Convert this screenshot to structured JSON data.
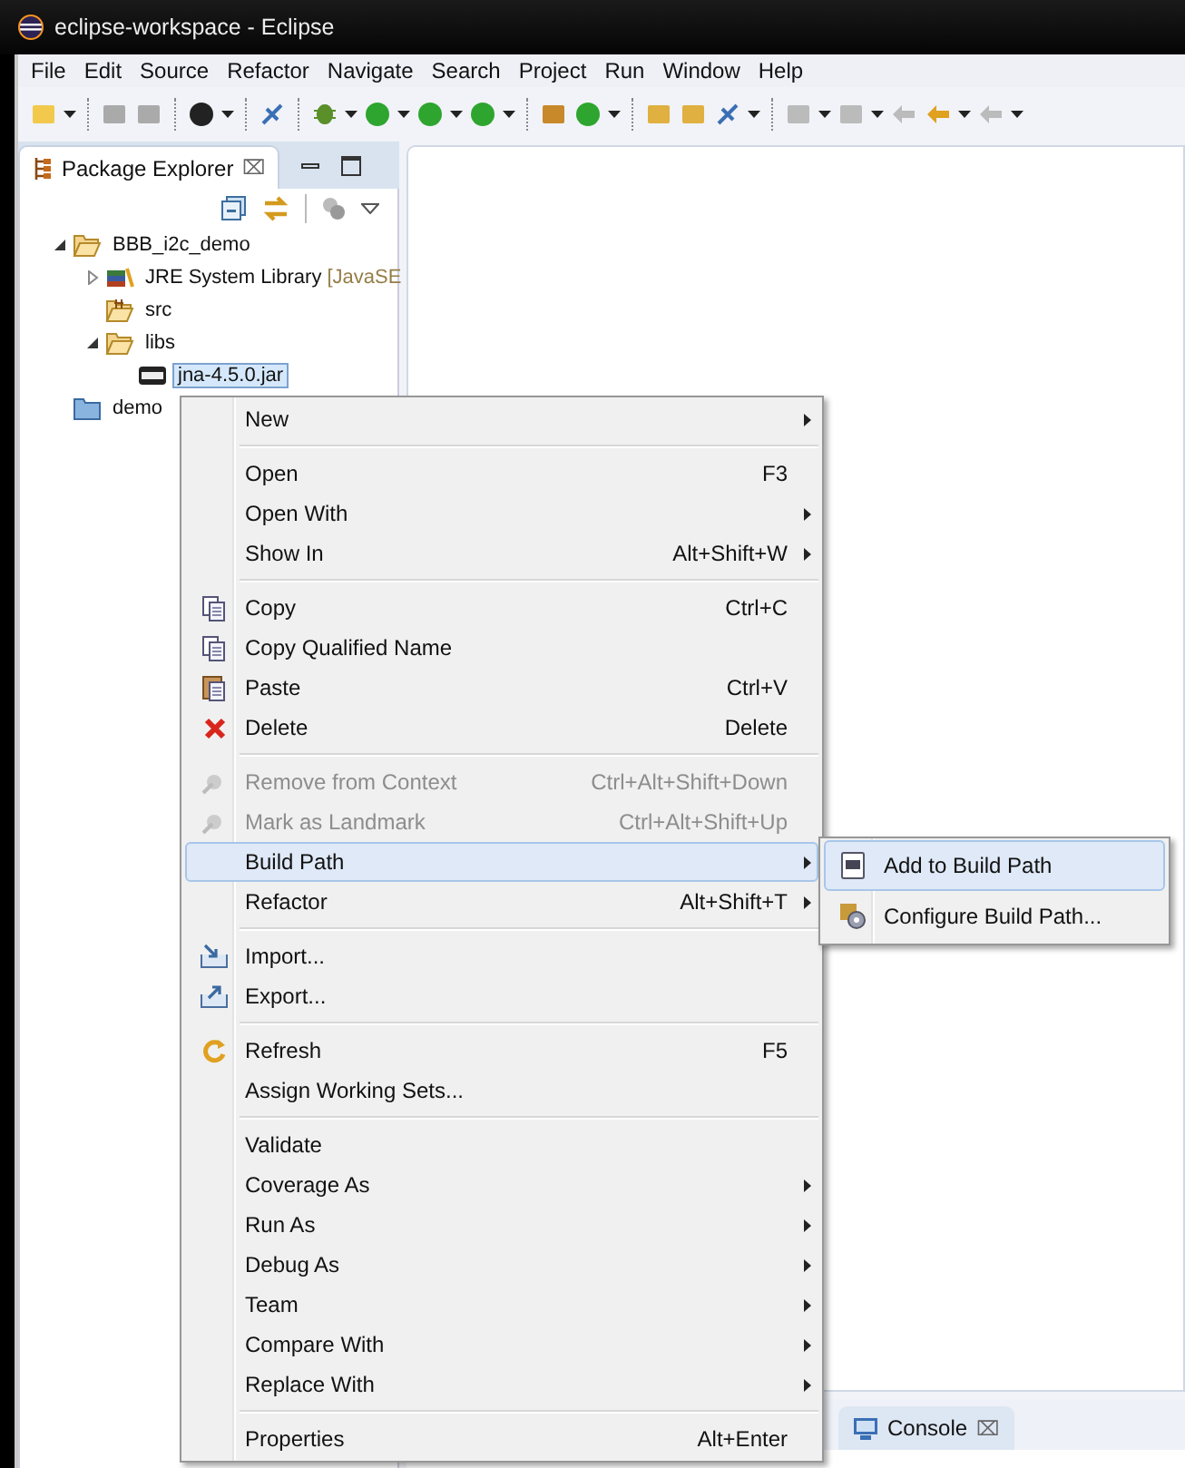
{
  "window": {
    "title": "eclipse-workspace - Eclipse"
  },
  "menu_bar": [
    "File",
    "Edit",
    "Source",
    "Refactor",
    "Navigate",
    "Search",
    "Project",
    "Run",
    "Window",
    "Help"
  ],
  "package_explorer": {
    "title": "Package Explorer",
    "close": "⌧",
    "tree": [
      {
        "label": "BBB_i2c_demo",
        "kind": "project",
        "expanded": true,
        "selected": false,
        "children": [
          {
            "label": "JRE System Library",
            "decoration": "[JavaSE",
            "kind": "library",
            "expanded": false,
            "selected": false
          },
          {
            "label": "src",
            "kind": "source",
            "selected": false
          },
          {
            "label": "libs",
            "kind": "folder",
            "expanded": true,
            "selected": false,
            "children": [
              {
                "label": "jna-4.5.0.jar",
                "kind": "jar",
                "selected": true
              }
            ]
          }
        ]
      },
      {
        "label": "demo",
        "kind": "closed-project",
        "selected": false
      }
    ]
  },
  "context_menu": {
    "items": [
      {
        "kind": "item",
        "label": "New",
        "submenu": true,
        "disabled": false,
        "selected": false
      },
      {
        "kind": "separator"
      },
      {
        "kind": "item",
        "label": "Open",
        "shortcut": "F3",
        "disabled": false,
        "selected": false
      },
      {
        "kind": "item",
        "label": "Open With",
        "submenu": true,
        "disabled": false,
        "selected": false
      },
      {
        "kind": "item",
        "label": "Show In",
        "shortcut": "Alt+Shift+W",
        "submenu": true,
        "disabled": false,
        "selected": false
      },
      {
        "kind": "separator"
      },
      {
        "kind": "item",
        "label": "Copy",
        "shortcut": "Ctrl+C",
        "disabled": false,
        "selected": false
      },
      {
        "kind": "item",
        "label": "Copy Qualified Name",
        "disabled": false,
        "selected": false
      },
      {
        "kind": "item",
        "label": "Paste",
        "shortcut": "Ctrl+V",
        "disabled": false,
        "selected": false
      },
      {
        "kind": "item",
        "label": "Delete",
        "shortcut": "Delete",
        "disabled": false,
        "selected": false
      },
      {
        "kind": "separator"
      },
      {
        "kind": "item",
        "label": "Remove from Context",
        "shortcut": "Ctrl+Alt+Shift+Down",
        "disabled": true,
        "selected": false
      },
      {
        "kind": "item",
        "label": "Mark as Landmark",
        "shortcut": "Ctrl+Alt+Shift+Up",
        "disabled": true,
        "selected": false
      },
      {
        "kind": "item",
        "label": "Build Path",
        "submenu": true,
        "disabled": false,
        "selected": true
      },
      {
        "kind": "item",
        "label": "Refactor",
        "shortcut": "Alt+Shift+T",
        "submenu": true,
        "disabled": false,
        "selected": false
      },
      {
        "kind": "separator"
      },
      {
        "kind": "item",
        "label": "Import...",
        "disabled": false,
        "selected": false
      },
      {
        "kind": "item",
        "label": "Export...",
        "disabled": false,
        "selected": false
      },
      {
        "kind": "separator"
      },
      {
        "kind": "item",
        "label": "Refresh",
        "shortcut": "F5",
        "disabled": false,
        "selected": false
      },
      {
        "kind": "item",
        "label": "Assign Working Sets...",
        "disabled": false,
        "selected": false
      },
      {
        "kind": "separator"
      },
      {
        "kind": "item",
        "label": "Validate",
        "disabled": false,
        "selected": false
      },
      {
        "kind": "item",
        "label": "Coverage As",
        "submenu": true,
        "disabled": false,
        "selected": false
      },
      {
        "kind": "item",
        "label": "Run As",
        "submenu": true,
        "disabled": false,
        "selected": false
      },
      {
        "kind": "item",
        "label": "Debug As",
        "submenu": true,
        "disabled": false,
        "selected": false
      },
      {
        "kind": "item",
        "label": "Team",
        "submenu": true,
        "disabled": false,
        "selected": false
      },
      {
        "kind": "item",
        "label": "Compare With",
        "submenu": true,
        "disabled": false,
        "selected": false
      },
      {
        "kind": "item",
        "label": "Replace With",
        "submenu": true,
        "disabled": false,
        "selected": false
      },
      {
        "kind": "separator"
      },
      {
        "kind": "item",
        "label": "Properties",
        "shortcut": "Alt+Enter",
        "disabled": false,
        "selected": false
      }
    ]
  },
  "submenu": {
    "items": [
      {
        "label": "Add to Build Path",
        "selected": true
      },
      {
        "label": "Configure Build Path...",
        "selected": false
      }
    ]
  },
  "bottom_panel": {
    "tabs": [
      {
        "label": "Console",
        "close": "⌧",
        "selected": true
      }
    ]
  }
}
